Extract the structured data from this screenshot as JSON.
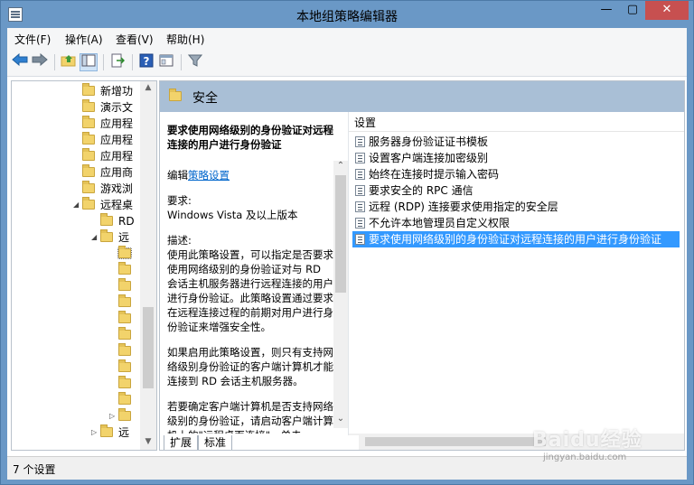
{
  "window": {
    "title": "本地组策略编辑器"
  },
  "titlebar": {
    "minimize": "—",
    "maximize": "▢",
    "close": "✕"
  },
  "menubar": {
    "items": [
      "文件(F)",
      "操作(A)",
      "查看(V)",
      "帮助(H)"
    ]
  },
  "toolbar": {
    "icons": [
      "back-arrow-icon",
      "forward-arrow-icon",
      "up-folder-icon",
      "show-hide-tree-icon",
      "export-list-icon",
      "help-icon",
      "properties-icon",
      "filter-icon"
    ]
  },
  "tree": {
    "items": [
      {
        "label": "新增功",
        "level": 2
      },
      {
        "label": "演示文",
        "level": 2
      },
      {
        "label": "应用程",
        "level": 2
      },
      {
        "label": "应用程",
        "level": 2
      },
      {
        "label": "应用程",
        "level": 2
      },
      {
        "label": "应用商",
        "level": 2
      },
      {
        "label": "游戏浏",
        "level": 2
      },
      {
        "label": "远程桌",
        "level": 2,
        "expanded": true
      },
      {
        "label": "RD",
        "level": 3
      },
      {
        "label": "远",
        "level": 3,
        "expanded": true
      },
      {
        "label": "",
        "level": 4
      },
      {
        "label": "",
        "level": 4
      },
      {
        "label": "",
        "level": 4
      },
      {
        "label": "",
        "level": 4
      },
      {
        "label": "",
        "level": 4
      },
      {
        "label": "",
        "level": 4
      },
      {
        "label": "",
        "level": 4
      },
      {
        "label": "",
        "level": 4
      },
      {
        "label": "",
        "level": 4
      },
      {
        "label": "",
        "level": 4
      },
      {
        "label": "",
        "level": 4,
        "collapsed": true
      },
      {
        "label": "远",
        "level": 3,
        "collapsed": true
      }
    ]
  },
  "detail": {
    "header_title": "安全",
    "description": {
      "heading": "要求使用网络级别的身份验证对远程连接的用户进行身份验证",
      "edit_prefix": "编辑",
      "edit_link": "策略设置",
      "requirement_label": "要求:",
      "requirement_value": "Windows Vista 及以上版本",
      "desc_label": "描述:",
      "desc_para1": "使用此策略设置，可以指定是否要求使用网络级别的身份验证对与 RD 会话主机服务器进行远程连接的用户进行身份验证。此策略设置通过要求在远程连接过程的前期对用户进行身份验证来增强安全性。",
      "desc_para2": "如果启用此策略设置，则只有支持网络级别身份验证的客户端计算机才能连接到 RD 会话主机服务器。",
      "desc_para3": "若要确定客户端计算机是否支持网络级别的身份验证，请启动客户端计算机上的\"远程桌面连接\"，单击"
    },
    "list": {
      "column_header": "设置",
      "items": [
        "服务器身份验证证书模板",
        "设置客户端连接加密级别",
        "始终在连接时提示输入密码",
        "要求安全的 RPC 通信",
        "远程 (RDP) 连接要求使用指定的安全层",
        "不允许本地管理员自定义权限",
        "要求使用网络级别的身份验证对远程连接的用户进行身份验证"
      ],
      "selected_index": 6
    },
    "tabs": [
      "扩展",
      "标准"
    ]
  },
  "statusbar": {
    "text": "7 个设置"
  },
  "watermark": {
    "text": "Baidu经验",
    "url": "jingyan.baidu.com"
  }
}
